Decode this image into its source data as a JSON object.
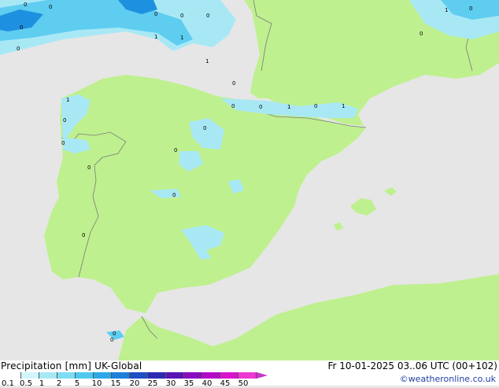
{
  "map": {
    "colors": {
      "sea": "#e6e6e6",
      "land": "#bff08f",
      "border": "#7a7a7a",
      "precip_light": "#a8e8f5",
      "precip_mid": "#5ecdf0",
      "precip_heavy": "#1e90e0"
    },
    "labels": [
      "0",
      "0",
      "0",
      "0",
      "0",
      "0",
      "0",
      "1",
      "1",
      "0",
      "0",
      "1",
      "0",
      "0",
      "0",
      "0",
      "1",
      "0",
      "0",
      "0",
      "0",
      "0",
      "1",
      "0",
      "0",
      "1",
      "0",
      "0",
      "1"
    ]
  },
  "footer": {
    "title_left": "Precipitation [mm]  UK-Global",
    "title_right": "Fr 10-01-2025 03..06 UTC (00+102)",
    "credit": "©weatheronline.co.uk",
    "scale_colors": [
      "#ffffff",
      "#d2f5fb",
      "#a8e8f5",
      "#7edcf3",
      "#4ec8ee",
      "#2ea8e6",
      "#1e7fd8",
      "#1f4fc4",
      "#2a2ab4",
      "#5a14b4",
      "#8a0ac0",
      "#b40ac8",
      "#d814cc",
      "#ee38d4"
    ],
    "scale_ticks": [
      "0.1",
      "0.5",
      "1",
      "2",
      "5",
      "10",
      "15",
      "20",
      "25",
      "30",
      "35",
      "40",
      "45",
      "50"
    ]
  }
}
